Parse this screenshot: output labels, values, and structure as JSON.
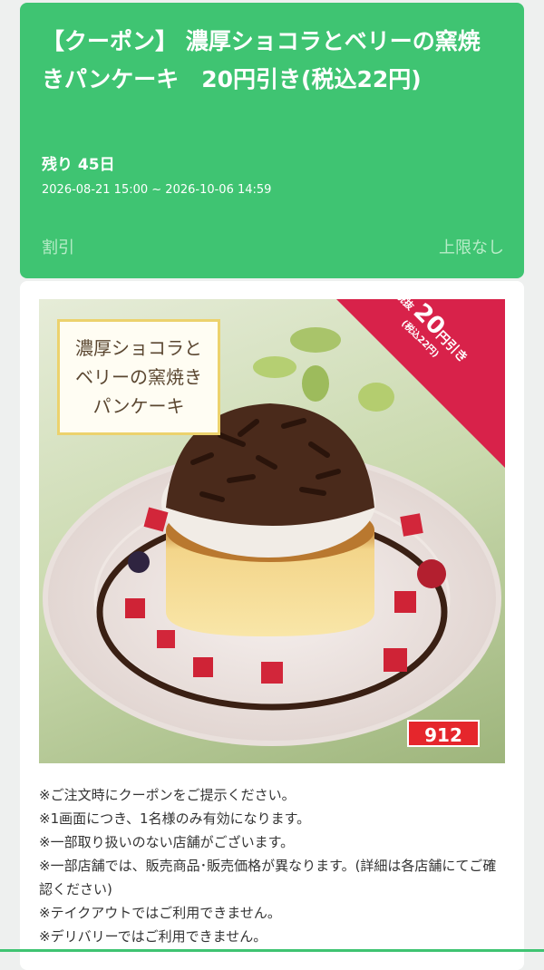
{
  "coupon": {
    "title": "【クーポン】 濃厚ショコラとベリーの窯焼きパンケーキ　20円引き(税込22円)",
    "remaining": "残り 45日",
    "period": "2026-08-21 15:00 ~ 2026-10-06 14:59",
    "discount_label": "割引",
    "limit_label": "上限なし"
  },
  "image": {
    "product_name": "濃厚ショコラと\nベリーの窯焼き\nパンケーキ",
    "corner_prefix": "税抜",
    "corner_amount": "20",
    "corner_unit": "円引き",
    "corner_tax": "(税込22円)",
    "code": "912"
  },
  "notes": [
    "※ご注文時にクーポンをご提示ください。",
    "※1画面につき、1名様のみ有効になります。",
    "※一部取り扱いのない店舗がございます。",
    "※一部店舗では、販売商品･販売価格が異なります。(詳細は各店舗にてご確認ください)",
    "※テイクアウトではご利用できません。",
    "※デリバリーではご利用できません。"
  ],
  "colors": {
    "header_green": "#3fc472",
    "badge_red": "#e5262c",
    "corner_red": "#d8224a"
  }
}
